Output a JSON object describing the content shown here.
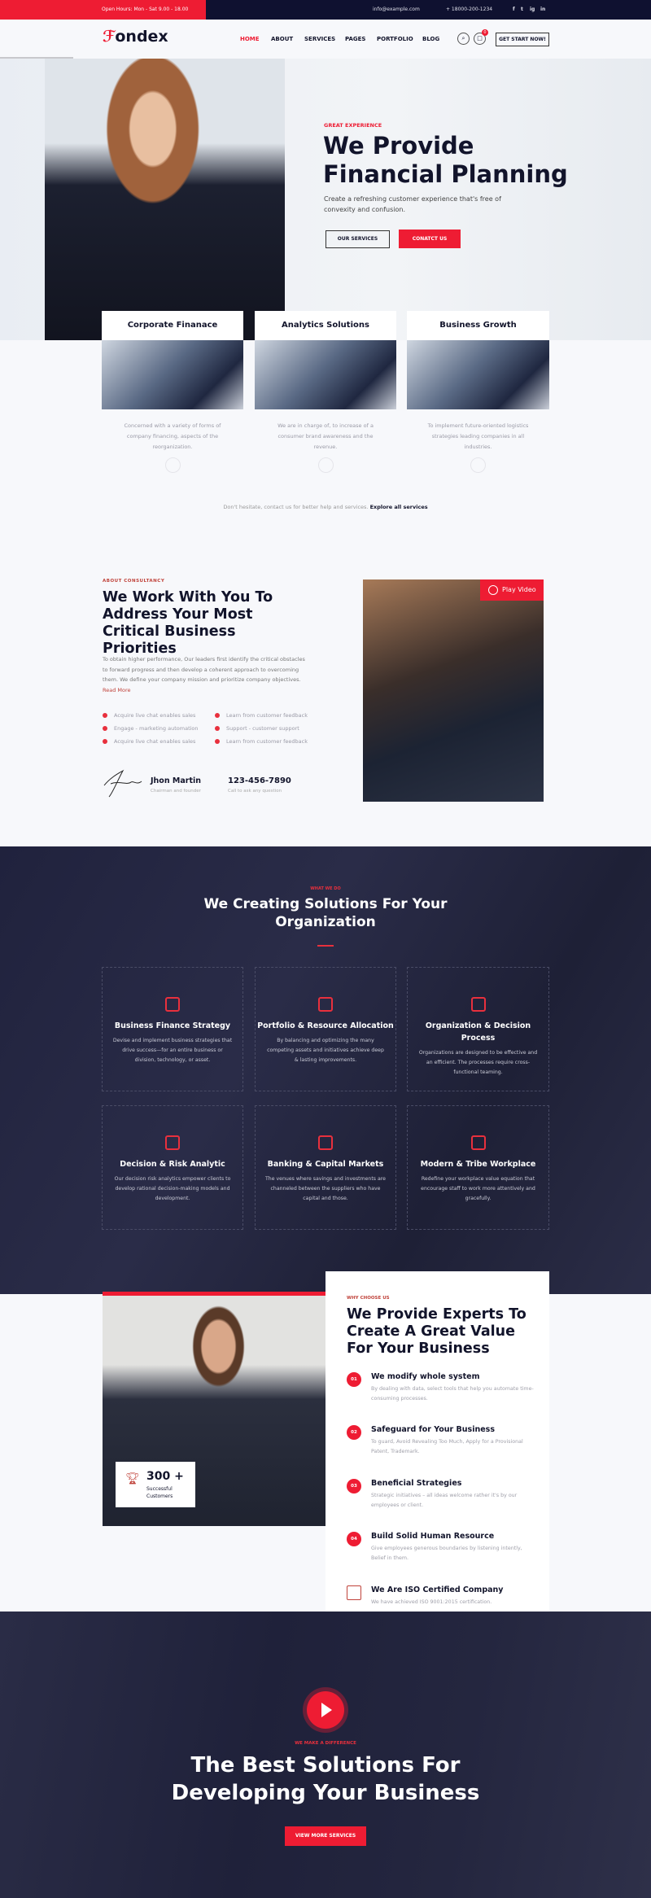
{
  "topbar": {
    "hours": "Open Hours: Mon - Sat 9.00 - 18.00",
    "email": "info@example.com",
    "phone": "+ 18000-200-1234",
    "social": [
      "f",
      "t",
      "ig",
      "in"
    ]
  },
  "header": {
    "logo": "ondex",
    "nav": [
      "HOME",
      "ABOUT",
      "SERVICES",
      "PAGES",
      "PORTFOLIO",
      "BLOG"
    ],
    "cart_count": "0",
    "cta": "GET START NOW!"
  },
  "hero": {
    "eyebrow": "GREAT EXPERIENCE",
    "title_line1": "We Provide",
    "title_line2": "Financial Planning",
    "subtitle": "Create a refreshing customer experience that's free of convexity and confusion.",
    "btn_services": "OUR SERVICES",
    "btn_contact": "CONATCT US"
  },
  "services": [
    {
      "title": "Corporate Finanace",
      "desc": "Concerned with a variety of forms of company financing, aspects of the reorganization."
    },
    {
      "title": "Analytics Solutions",
      "desc": "We are in charge of, to increase of a consumer brand awareness and the revenue."
    },
    {
      "title": "Business Growth",
      "desc": "To implement future-oriented logistics strategies leading companies in all industries."
    }
  ],
  "services_footer": {
    "text": "Don't hesitate, contact us for better help and services.",
    "link": "Explore all services"
  },
  "about": {
    "eyebrow": "ABOUT CONSULTANCY",
    "title": "We Work With You To Address Your Most Critical Business Priorities",
    "para": "To obtain higher performance, Our leaders first identify the critical obstacles to forward progress and then develop a coherent approach to overcoming them. We define your company mission and prioritize company objectives.",
    "read_more": "Read More",
    "list": [
      "Acquire live chat enables sales",
      "Learn from customer feedback",
      "Engage - marketing automation",
      "Support - customer support",
      "Acquire live chat enables sales",
      "Learn from customer feedback"
    ],
    "name": "Jhon Martin",
    "role": "Chairman and founder",
    "phone": "123-456-7890",
    "phone_note": "Call to ask any question",
    "play": "Play Video"
  },
  "whatwedo": {
    "eyebrow": "WHAT WE DO",
    "title": "We Creating Solutions For Your Organization",
    "items": [
      {
        "title": "Business Finance Strategy",
        "desc": "Devise and implement business strategies that drive success—for an entire business or division, technology, or asset."
      },
      {
        "title": "Portfolio & Resource Allocation",
        "desc": "By balancing and optimizing the many competing assets and initiatives achieve deep & lasting improvements."
      },
      {
        "title": "Organization & Decision Process",
        "desc": "Organizations are designed to be effective and an efficient. The processes require cross-functional teaming."
      },
      {
        "title": "Decision & Risk Analytic",
        "desc": "Our decision risk analytics empower clients to develop rational decision-making models and development."
      },
      {
        "title": "Banking & Capital Markets",
        "desc": "The venues where savings and investments are channeled between the suppliers who have capital and those."
      },
      {
        "title": "Modern & Tribe Workplace",
        "desc": "Redefine your workplace value equation that encourage staff to work more attentively and gracefully."
      }
    ]
  },
  "why": {
    "eyebrow": "WHY CHOOSE US",
    "title": "We Provide Experts To Create A Great Value For Your Business",
    "counter": "300 +",
    "counter_label": "Successful Customers",
    "steps": [
      {
        "num": "01",
        "title": "We modify whole system",
        "desc": "By dealing with data, select tools that help you automate time-consuming processes."
      },
      {
        "num": "02",
        "title": "Safeguard for Your Business",
        "desc": "To guard, Avoid Revealing Too Much, Apply for a Provisional Patent, Trademark."
      },
      {
        "num": "03",
        "title": "Beneficial Strategies",
        "desc": "Strategic initiatives – all ideas welcome rather it's by our employees or client."
      },
      {
        "num": "04",
        "title": "Build Solid Human Resource",
        "desc": "Give employees generous boundaries by listening intently, Belief in them."
      }
    ],
    "iso_title": "We Are ISO Certified Company",
    "iso_desc": "We have achieved ISO 9001:2015 certification."
  },
  "cta": {
    "eyebrow": "WE MAKE A DIFFERENCE",
    "title_line1": "The Best Solutions For",
    "title_line2": "Developing Your Business",
    "button": "VIEW MORE SERVICES"
  },
  "colors": {
    "accent": "#ee1c33",
    "navy": "#0f1130"
  }
}
